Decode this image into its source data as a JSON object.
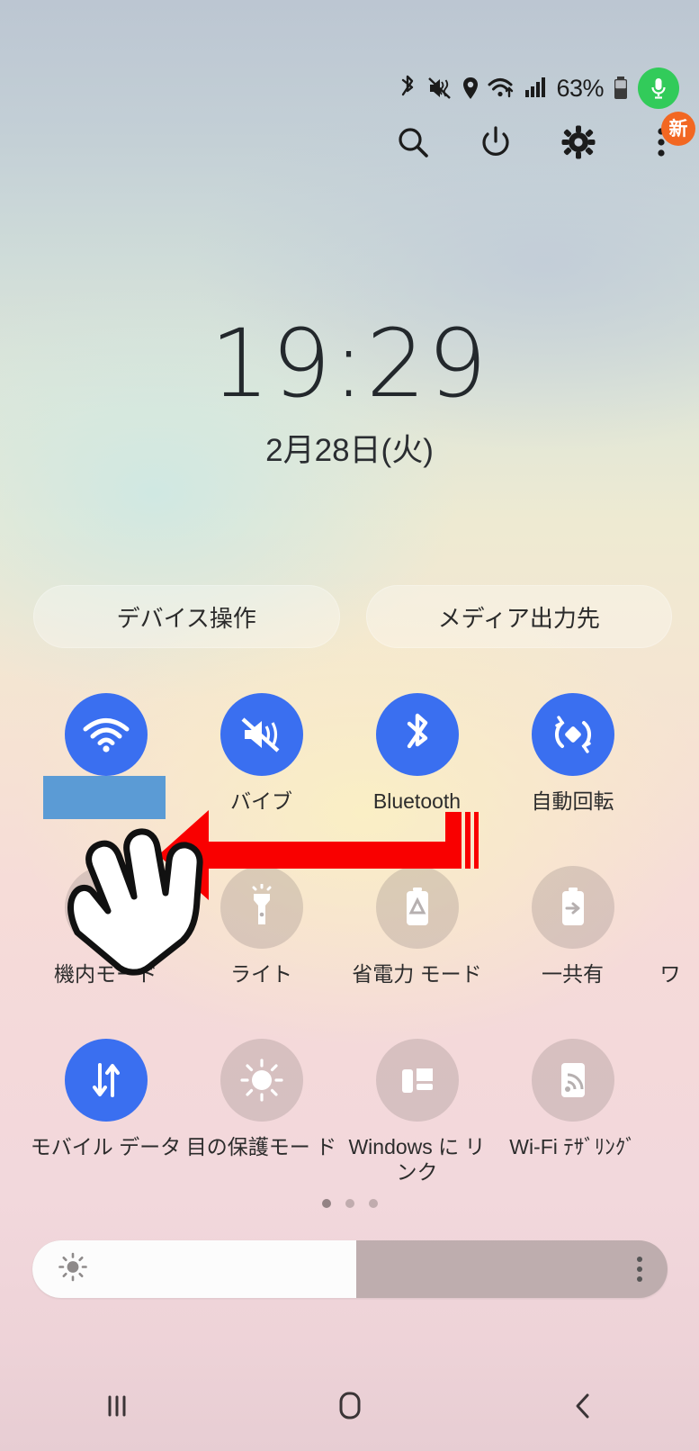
{
  "status_bar": {
    "battery_percent": "63%",
    "icons": [
      "bluetooth-icon",
      "mute-vibrate-icon",
      "location-icon",
      "wifi-icon",
      "signal-icon",
      "battery-icon",
      "microphone-icon"
    ],
    "mic_badge_color": "#32cb5a"
  },
  "header": {
    "icons": [
      "search-icon",
      "power-icon",
      "settings-gear-icon",
      "overflow-menu-icon"
    ],
    "badge_label": "新",
    "badge_color": "#f26722"
  },
  "clock": {
    "time": "19:29",
    "date": "2月28日(火)"
  },
  "pills": [
    {
      "label": "デバイス操作"
    },
    {
      "label": "メディア出力先"
    }
  ],
  "quick_settings": {
    "accent_on": "#3a6ff0",
    "rows": [
      [
        {
          "label": "",
          "icon": "wifi-icon",
          "state": "on",
          "redacted": true
        },
        {
          "label": "バイブ",
          "icon": "vibrate-icon",
          "state": "on"
        },
        {
          "label": "Bluetooth",
          "icon": "bluetooth-icon",
          "state": "on"
        },
        {
          "label": "自動回転",
          "icon": "auto-rotate-icon",
          "state": "on"
        }
      ],
      [
        {
          "label": "機内モード",
          "icon": "airplane-icon",
          "state": "off"
        },
        {
          "label": "ライト",
          "icon": "flashlight-icon",
          "state": "off"
        },
        {
          "label": "省電力\nモード",
          "icon": "power-saving-icon",
          "state": "off"
        },
        {
          "label": "一共有",
          "icon": "share-battery-icon",
          "state": "off",
          "peek_label": "ワ"
        }
      ],
      [
        {
          "label": "モバイル\nデータ",
          "icon": "mobile-data-icon",
          "state": "on"
        },
        {
          "label": "目の保護モー\nド",
          "icon": "eye-comfort-icon",
          "state": "off"
        },
        {
          "label": "Windows に\nリンク",
          "icon": "link-to-windows-icon",
          "state": "off"
        },
        {
          "label": "Wi-Fi\nﾃｻﾞﾘﾝｸﾞ",
          "icon": "wifi-hotspot-icon",
          "state": "off"
        }
      ]
    ],
    "page_dots": {
      "count": 3,
      "active_index": 0
    }
  },
  "brightness": {
    "value_percent": 51,
    "icon": "brightness-sun-icon",
    "menu_icon": "overflow-menu-icon"
  },
  "nav_bar": {
    "buttons": [
      "recents-button",
      "home-button",
      "back-button"
    ]
  },
  "annotations": {
    "arrow_color": "#f90000",
    "arrow_direction": "left",
    "cursor": "hand-cursor",
    "redaction_color": "#5b9bd5"
  }
}
